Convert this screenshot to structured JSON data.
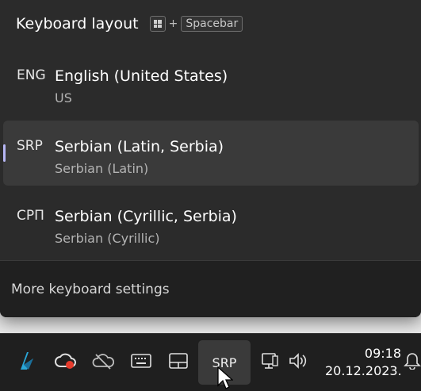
{
  "flyout": {
    "title": "Keyboard layout",
    "shortcut_plus": "+",
    "shortcut_key": "Spacebar",
    "shortcut_icon": "windows-key-icon",
    "items": [
      {
        "code": "ENG",
        "name": "English (United States)",
        "layout": "US",
        "selected": false
      },
      {
        "code": "SRP",
        "name": "Serbian (Latin, Serbia)",
        "layout": "Serbian (Latin)",
        "selected": true
      },
      {
        "code": "СРП",
        "name": "Serbian (Cyrillic, Serbia)",
        "layout": "Serbian (Cyrillic)",
        "selected": false
      }
    ],
    "footer_link": "More keyboard settings"
  },
  "taskbar": {
    "icons": [
      "app-logo-icon",
      "creative-cloud-icon",
      "onedrive-icon",
      "touch-keyboard-icon",
      "tablet-mode-icon"
    ],
    "language_indicator": "SRP",
    "tray_icons": [
      "network-icon",
      "volume-icon",
      "notifications-icon"
    ],
    "time": "09:18",
    "date": "20.12.2023."
  },
  "colors": {
    "flyout_bg": "#2b2b2b",
    "selected_bg": "#3a3a3a",
    "accent": "#b6b6f5",
    "taskbar_bg": "#1f1f1f"
  }
}
